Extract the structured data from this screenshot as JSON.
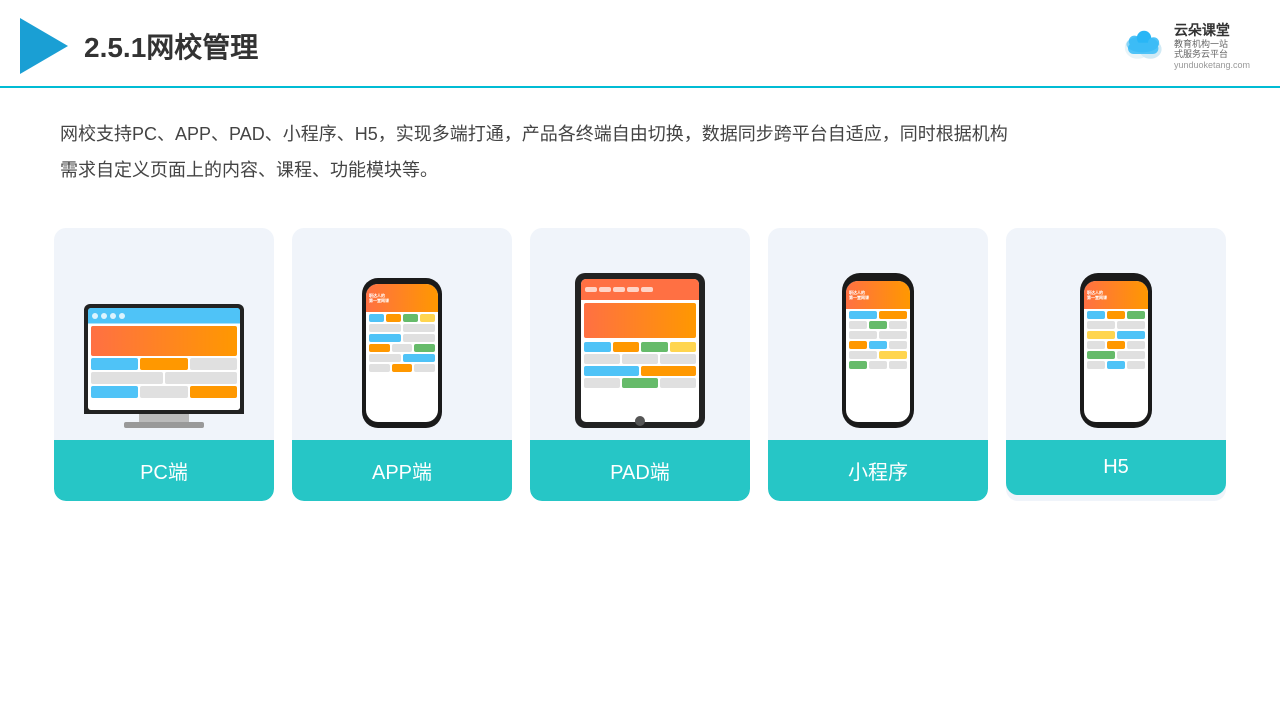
{
  "header": {
    "section_number": "2.5.1",
    "title": "网校管理",
    "brand": {
      "name": "云朵课堂",
      "sub": "教育机构一站\n式服务云平台",
      "url": "yunduoketang.com"
    }
  },
  "description": "网校支持PC、APP、PAD、小程序、H5，实现多端打通，产品各终端自由切换，数据同步跨平台自适应，同时根据机构\n需求自定义页面上的内容、课程、功能模块等。",
  "cards": [
    {
      "id": "pc",
      "label": "PC端"
    },
    {
      "id": "app",
      "label": "APP端"
    },
    {
      "id": "pad",
      "label": "PAD端"
    },
    {
      "id": "miniprogram",
      "label": "小程序"
    },
    {
      "id": "h5",
      "label": "H5"
    }
  ],
  "colors": {
    "teal": "#26c6c6",
    "header_line": "#00bcd4",
    "bg_card": "#f0f4fa"
  }
}
